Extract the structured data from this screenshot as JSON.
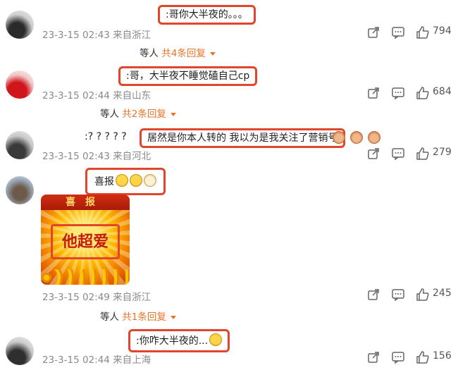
{
  "comments": [
    {
      "text": ":哥你大半夜的。。。",
      "meta": "23-3-15 02:43 来自浙江",
      "likes": "794",
      "replies_prefix": "等人",
      "replies_link": "共4条回复"
    },
    {
      "text": ":哥，大半夜不睡觉磕自己cp",
      "meta": "23-3-15 02:44 来自山东",
      "likes": "684",
      "replies_prefix": "等人",
      "replies_link": "共2条回复"
    },
    {
      "prefix": ":? ? ? ? ?",
      "text": "居然是你本人转的 我以为是我关注了营销号",
      "meta": "23-3-15 02:43 来自河北",
      "likes": "279"
    },
    {
      "text": "喜报",
      "meta": "23-3-15 02:49 来自浙江",
      "likes": "245",
      "replies_prefix": "等人",
      "replies_link": "共1条回复",
      "poster": {
        "banner": "喜报",
        "word": "他超爱"
      }
    },
    {
      "text": ":你咋大半夜的...",
      "meta": "23-3-15 02:44 来自上海",
      "likes": "156"
    }
  ],
  "icons": [
    "share-icon",
    "comment-icon",
    "like-icon"
  ],
  "colors": {
    "highlight": "#e2452b",
    "reply_link": "#e8742a",
    "meta_text": "#8a8a8a"
  }
}
